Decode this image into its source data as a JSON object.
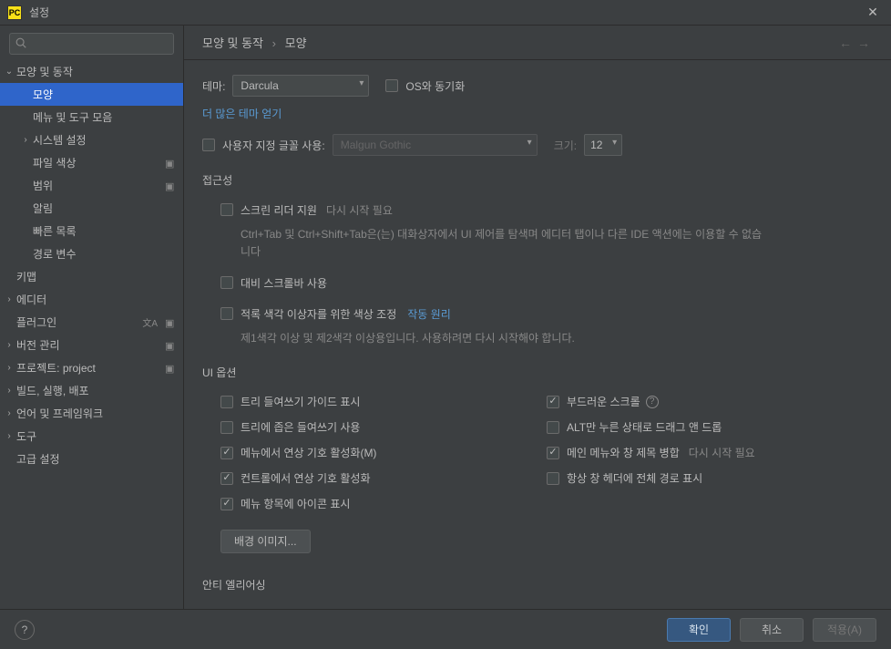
{
  "window": {
    "app_icon": "PC",
    "title": "설정"
  },
  "search": {
    "placeholder": ""
  },
  "sidebar": {
    "items": [
      {
        "label": "모양 및 동작",
        "level": 0,
        "chev": "down",
        "selected": false,
        "badge": ""
      },
      {
        "label": "모양",
        "level": 1,
        "chev": "",
        "selected": true,
        "badge": ""
      },
      {
        "label": "메뉴 및 도구 모음",
        "level": 1,
        "chev": "",
        "selected": false,
        "badge": ""
      },
      {
        "label": "시스템 설정",
        "level": 1,
        "chev": "right",
        "selected": false,
        "badge": ""
      },
      {
        "label": "파일 색상",
        "level": 1,
        "chev": "",
        "selected": false,
        "badge": "proj"
      },
      {
        "label": "범위",
        "level": 1,
        "chev": "",
        "selected": false,
        "badge": "proj"
      },
      {
        "label": "알림",
        "level": 1,
        "chev": "",
        "selected": false,
        "badge": ""
      },
      {
        "label": "빠른 목록",
        "level": 1,
        "chev": "",
        "selected": false,
        "badge": ""
      },
      {
        "label": "경로 변수",
        "level": 1,
        "chev": "",
        "selected": false,
        "badge": ""
      },
      {
        "label": "키맵",
        "level": 0,
        "chev": "",
        "selected": false,
        "badge": ""
      },
      {
        "label": "에디터",
        "level": 0,
        "chev": "right",
        "selected": false,
        "badge": ""
      },
      {
        "label": "플러그인",
        "level": 0,
        "chev": "",
        "selected": false,
        "badge": "lang+proj"
      },
      {
        "label": "버전 관리",
        "level": 0,
        "chev": "right",
        "selected": false,
        "badge": "proj"
      },
      {
        "label": "프로젝트: project",
        "level": 0,
        "chev": "right",
        "selected": false,
        "badge": "proj"
      },
      {
        "label": "빌드, 실행, 배포",
        "level": 0,
        "chev": "right",
        "selected": false,
        "badge": ""
      },
      {
        "label": "언어 및 프레임워크",
        "level": 0,
        "chev": "right",
        "selected": false,
        "badge": ""
      },
      {
        "label": "도구",
        "level": 0,
        "chev": "right",
        "selected": false,
        "badge": ""
      },
      {
        "label": "고급 설정",
        "level": 0,
        "chev": "",
        "selected": false,
        "badge": ""
      }
    ]
  },
  "breadcrumb": {
    "parent": "모양 및 동작",
    "current": "모양"
  },
  "theme": {
    "label": "테마:",
    "value": "Darcula",
    "sync_os": "OS와 동기화",
    "more_themes": "더 많은 테마 얻기"
  },
  "font": {
    "custom_label": "사용자 지정 글꼴 사용:",
    "family": "Malgun Gothic",
    "size_label": "크기:",
    "size_value": "12"
  },
  "a11y": {
    "title": "접근성",
    "screen_reader": "스크린 리더 지원",
    "restart_hint": "다시 시작 필요",
    "screen_reader_desc": "Ctrl+Tab 및 Ctrl+Shift+Tab은(는) 대화상자에서 UI 제어를 탐색며 에디터 탭이나 다른 IDE 액션에는 이용할 수 없습니다",
    "contrast_scroll": "대비 스크롤바 사용",
    "color_deficiency": "적록 색각 이상자를 위한 색상 조정",
    "how_it_works": "작동 원리",
    "color_desc": "제1색각 이상 및 제2색각 이상용입니다. 사용하려면 다시 시작해야 합니다."
  },
  "ui_options": {
    "title": "UI 옵션",
    "left": [
      {
        "label": "트리 들여쓰기 가이드 표시",
        "checked": false
      },
      {
        "label": "트리에 좁은 들여쓰기 사용",
        "checked": false
      },
      {
        "label": "메뉴에서 연상 기호 활성화(M)",
        "checked": true
      },
      {
        "label": "컨트롤에서 연상 기호 활성화",
        "checked": true
      },
      {
        "label": "메뉴 항목에 아이콘 표시",
        "checked": true
      }
    ],
    "right": [
      {
        "label": "부드러운 스크롤",
        "checked": true,
        "help": true
      },
      {
        "label": "ALT만 누른 상태로 드래그 앤 드롭",
        "checked": false
      },
      {
        "label": "메인 메뉴와 창 제목 병합",
        "checked": true,
        "hint": "다시 시작 필요"
      },
      {
        "label": "항상 창 헤더에 전체 경로 표시",
        "checked": false
      }
    ],
    "bg_image_btn": "배경 이미지..."
  },
  "antialias": {
    "title": "안티 엘리어싱"
  },
  "footer": {
    "ok": "확인",
    "cancel": "취소",
    "apply": "적용(A)"
  }
}
